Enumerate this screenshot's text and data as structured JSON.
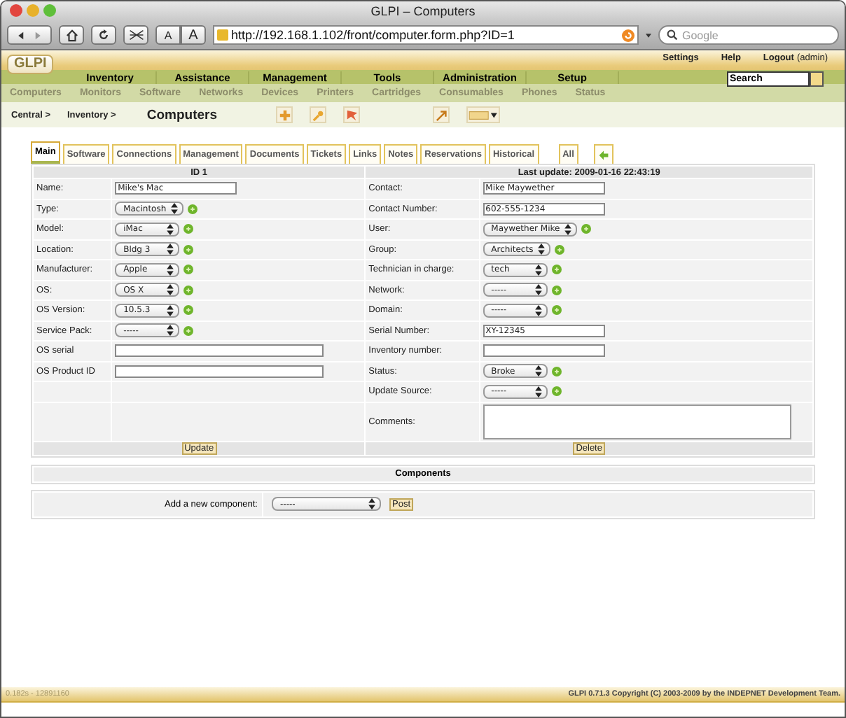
{
  "window": {
    "title": "GLPI – Computers"
  },
  "browser": {
    "font_buttons": [
      "A",
      "A"
    ],
    "url": "http://192.168.1.102/front/computer.form.php?ID=1",
    "search_placeholder": "Google"
  },
  "header": {
    "logo": "GLPI",
    "top_links": [
      "Settings",
      "Help",
      "Logout"
    ],
    "user": "(admin)",
    "search_value": "Search",
    "main_menu": [
      "Inventory",
      "Assistance",
      "Management",
      "Tools",
      "Administration",
      "Setup"
    ],
    "sub_menu": [
      "Computers",
      "Monitors",
      "Software",
      "Networks",
      "Devices",
      "Printers",
      "Cartridges",
      "Consumables",
      "Phones",
      "Status"
    ]
  },
  "breadcrumb": {
    "items": [
      "Central >",
      "Inventory >"
    ],
    "title": "Computers"
  },
  "tabs": [
    {
      "label": "Main",
      "selected": true,
      "kind": "page"
    },
    {
      "label": "Software",
      "selected": false,
      "kind": "page"
    },
    {
      "label": "Connections",
      "selected": false,
      "kind": "page"
    },
    {
      "label": "Management",
      "selected": false,
      "kind": "page"
    },
    {
      "label": "Documents",
      "selected": false,
      "kind": "page"
    },
    {
      "label": "Tickets",
      "selected": false,
      "kind": "page"
    },
    {
      "label": "Links",
      "selected": false,
      "kind": "page"
    },
    {
      "label": "Notes",
      "selected": false,
      "kind": "page"
    },
    {
      "label": "Reservations",
      "selected": false,
      "kind": "page"
    },
    {
      "label": "Historical",
      "selected": false,
      "kind": "page"
    },
    {
      "label": "All",
      "selected": false,
      "kind": "all"
    }
  ],
  "form": {
    "id_label": "ID 1",
    "last_update": "Last update: 2009-01-16 22:43:19",
    "left_fields": [
      {
        "kind": "text",
        "label": "Name:",
        "value": "Mike's Mac"
      },
      {
        "kind": "select",
        "label": "Type:",
        "value": "Macintosh"
      },
      {
        "kind": "select",
        "label": "Model:",
        "value": "iMac"
      },
      {
        "kind": "select",
        "label": "Location:",
        "value": "Bldg 3"
      },
      {
        "kind": "select",
        "label": "Manufacturer:",
        "value": "Apple"
      },
      {
        "kind": "select",
        "label": "OS:",
        "value": "OS X"
      },
      {
        "kind": "select",
        "label": "OS Version:",
        "value": "10.5.3"
      },
      {
        "kind": "select",
        "label": "Service Pack:",
        "value": "-----"
      },
      {
        "kind": "wide",
        "label": "OS serial"
      },
      {
        "kind": "wide",
        "label": "OS Product ID"
      }
    ],
    "right_fields": [
      {
        "kind": "text",
        "label": "Contact:",
        "value": "Mike Maywether"
      },
      {
        "kind": "text",
        "label": "Contact Number:",
        "value": "602-555-1234"
      },
      {
        "kind": "select",
        "label": "User:",
        "value": "Maywether Mike"
      },
      {
        "kind": "select",
        "label": "Group:",
        "value": "Architects"
      },
      {
        "kind": "select",
        "label": "Technician in charge:",
        "value": "tech"
      },
      {
        "kind": "select",
        "label": "Network:",
        "value": "-----"
      },
      {
        "kind": "select",
        "label": "Domain:",
        "value": "-----"
      },
      {
        "kind": "text",
        "label": "Serial Number:",
        "value": "XY-12345"
      },
      {
        "kind": "text",
        "label": "Inventory number:"
      },
      {
        "kind": "select",
        "label": "Status:",
        "value": "Broke"
      },
      {
        "kind": "select",
        "label": "Update Source:",
        "value": "-----"
      },
      {
        "kind": "textarea",
        "label": "Comments:"
      }
    ],
    "update_button": "Update",
    "delete_button": "Delete"
  },
  "components": {
    "title": "Components",
    "add_label": "Add a new component:",
    "select_value": "-----",
    "post_button": "Post"
  },
  "footer": {
    "timing": "0.182s - 12891160",
    "copyright": "GLPI 0.71.3 Copyright (C) 2003-2009 by the INDEPNET Development Team."
  }
}
